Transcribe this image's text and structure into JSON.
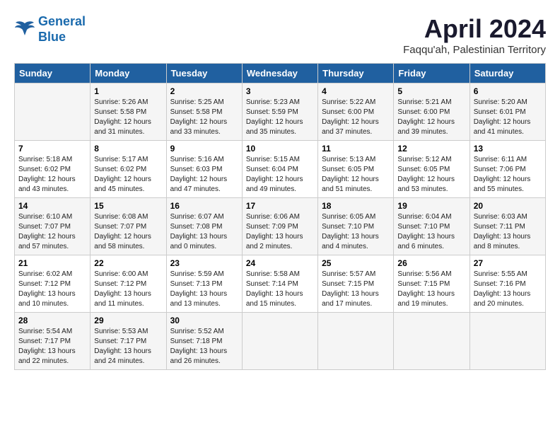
{
  "logo": {
    "line1": "General",
    "line2": "Blue"
  },
  "title": "April 2024",
  "subtitle": "Faqqu'ah, Palestinian Territory",
  "headers": [
    "Sunday",
    "Monday",
    "Tuesday",
    "Wednesday",
    "Thursday",
    "Friday",
    "Saturday"
  ],
  "weeks": [
    [
      {
        "day": "",
        "info": ""
      },
      {
        "day": "1",
        "info": "Sunrise: 5:26 AM\nSunset: 5:58 PM\nDaylight: 12 hours\nand 31 minutes."
      },
      {
        "day": "2",
        "info": "Sunrise: 5:25 AM\nSunset: 5:58 PM\nDaylight: 12 hours\nand 33 minutes."
      },
      {
        "day": "3",
        "info": "Sunrise: 5:23 AM\nSunset: 5:59 PM\nDaylight: 12 hours\nand 35 minutes."
      },
      {
        "day": "4",
        "info": "Sunrise: 5:22 AM\nSunset: 6:00 PM\nDaylight: 12 hours\nand 37 minutes."
      },
      {
        "day": "5",
        "info": "Sunrise: 5:21 AM\nSunset: 6:00 PM\nDaylight: 12 hours\nand 39 minutes."
      },
      {
        "day": "6",
        "info": "Sunrise: 5:20 AM\nSunset: 6:01 PM\nDaylight: 12 hours\nand 41 minutes."
      }
    ],
    [
      {
        "day": "7",
        "info": "Sunrise: 5:18 AM\nSunset: 6:02 PM\nDaylight: 12 hours\nand 43 minutes."
      },
      {
        "day": "8",
        "info": "Sunrise: 5:17 AM\nSunset: 6:02 PM\nDaylight: 12 hours\nand 45 minutes."
      },
      {
        "day": "9",
        "info": "Sunrise: 5:16 AM\nSunset: 6:03 PM\nDaylight: 12 hours\nand 47 minutes."
      },
      {
        "day": "10",
        "info": "Sunrise: 5:15 AM\nSunset: 6:04 PM\nDaylight: 12 hours\nand 49 minutes."
      },
      {
        "day": "11",
        "info": "Sunrise: 5:13 AM\nSunset: 6:05 PM\nDaylight: 12 hours\nand 51 minutes."
      },
      {
        "day": "12",
        "info": "Sunrise: 5:12 AM\nSunset: 6:05 PM\nDaylight: 12 hours\nand 53 minutes."
      },
      {
        "day": "13",
        "info": "Sunrise: 6:11 AM\nSunset: 7:06 PM\nDaylight: 12 hours\nand 55 minutes."
      }
    ],
    [
      {
        "day": "14",
        "info": "Sunrise: 6:10 AM\nSunset: 7:07 PM\nDaylight: 12 hours\nand 57 minutes."
      },
      {
        "day": "15",
        "info": "Sunrise: 6:08 AM\nSunset: 7:07 PM\nDaylight: 12 hours\nand 58 minutes."
      },
      {
        "day": "16",
        "info": "Sunrise: 6:07 AM\nSunset: 7:08 PM\nDaylight: 13 hours\nand 0 minutes."
      },
      {
        "day": "17",
        "info": "Sunrise: 6:06 AM\nSunset: 7:09 PM\nDaylight: 13 hours\nand 2 minutes."
      },
      {
        "day": "18",
        "info": "Sunrise: 6:05 AM\nSunset: 7:10 PM\nDaylight: 13 hours\nand 4 minutes."
      },
      {
        "day": "19",
        "info": "Sunrise: 6:04 AM\nSunset: 7:10 PM\nDaylight: 13 hours\nand 6 minutes."
      },
      {
        "day": "20",
        "info": "Sunrise: 6:03 AM\nSunset: 7:11 PM\nDaylight: 13 hours\nand 8 minutes."
      }
    ],
    [
      {
        "day": "21",
        "info": "Sunrise: 6:02 AM\nSunset: 7:12 PM\nDaylight: 13 hours\nand 10 minutes."
      },
      {
        "day": "22",
        "info": "Sunrise: 6:00 AM\nSunset: 7:12 PM\nDaylight: 13 hours\nand 11 minutes."
      },
      {
        "day": "23",
        "info": "Sunrise: 5:59 AM\nSunset: 7:13 PM\nDaylight: 13 hours\nand 13 minutes."
      },
      {
        "day": "24",
        "info": "Sunrise: 5:58 AM\nSunset: 7:14 PM\nDaylight: 13 hours\nand 15 minutes."
      },
      {
        "day": "25",
        "info": "Sunrise: 5:57 AM\nSunset: 7:15 PM\nDaylight: 13 hours\nand 17 minutes."
      },
      {
        "day": "26",
        "info": "Sunrise: 5:56 AM\nSunset: 7:15 PM\nDaylight: 13 hours\nand 19 minutes."
      },
      {
        "day": "27",
        "info": "Sunrise: 5:55 AM\nSunset: 7:16 PM\nDaylight: 13 hours\nand 20 minutes."
      }
    ],
    [
      {
        "day": "28",
        "info": "Sunrise: 5:54 AM\nSunset: 7:17 PM\nDaylight: 13 hours\nand 22 minutes."
      },
      {
        "day": "29",
        "info": "Sunrise: 5:53 AM\nSunset: 7:17 PM\nDaylight: 13 hours\nand 24 minutes."
      },
      {
        "day": "30",
        "info": "Sunrise: 5:52 AM\nSunset: 7:18 PM\nDaylight: 13 hours\nand 26 minutes."
      },
      {
        "day": "",
        "info": ""
      },
      {
        "day": "",
        "info": ""
      },
      {
        "day": "",
        "info": ""
      },
      {
        "day": "",
        "info": ""
      }
    ]
  ]
}
